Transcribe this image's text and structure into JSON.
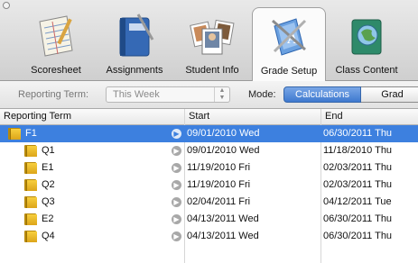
{
  "toolbar": {
    "tabs": [
      {
        "label": "Scoresheet",
        "icon": "scoresheet-icon"
      },
      {
        "label": "Assignments",
        "icon": "assignments-notebook-icon"
      },
      {
        "label": "Student Info",
        "icon": "student-photos-icon"
      },
      {
        "label": "Grade Setup",
        "icon": "grade-setup-icon"
      },
      {
        "label": "Class Content",
        "icon": "class-content-icon"
      }
    ],
    "active_tab": "Grade Setup"
  },
  "filter": {
    "reporting_term_label": "Reporting Term:",
    "reporting_term_value": "This Week",
    "mode_label": "Mode:",
    "mode_options": [
      "Calculations",
      "Grad"
    ],
    "mode_selected": "Calculations"
  },
  "table": {
    "columns": [
      "Reporting Term",
      "Start",
      "End"
    ],
    "rows": [
      {
        "term": "F1",
        "start": "09/01/2010 Wed",
        "end": "06/30/2011 Thu",
        "selected": true,
        "indent": 0
      },
      {
        "term": "Q1",
        "start": "09/01/2010 Wed",
        "end": "11/18/2010 Thu",
        "selected": false,
        "indent": 1
      },
      {
        "term": "E1",
        "start": "11/19/2010 Fri",
        "end": "02/03/2011 Thu",
        "selected": false,
        "indent": 1
      },
      {
        "term": "Q2",
        "start": "11/19/2010 Fri",
        "end": "02/03/2011 Thu",
        "selected": false,
        "indent": 1
      },
      {
        "term": "Q3",
        "start": "02/04/2011 Fri",
        "end": "04/12/2011 Tue",
        "selected": false,
        "indent": 1
      },
      {
        "term": "E2",
        "start": "04/13/2011 Wed",
        "end": "06/30/2011 Thu",
        "selected": false,
        "indent": 1
      },
      {
        "term": "Q4",
        "start": "04/13/2011 Wed",
        "end": "06/30/2011 Thu",
        "selected": false,
        "indent": 1
      }
    ]
  },
  "colors": {
    "selection": "#3d80df",
    "segment_active": "#3e79cf",
    "folder": "#f0c030"
  }
}
